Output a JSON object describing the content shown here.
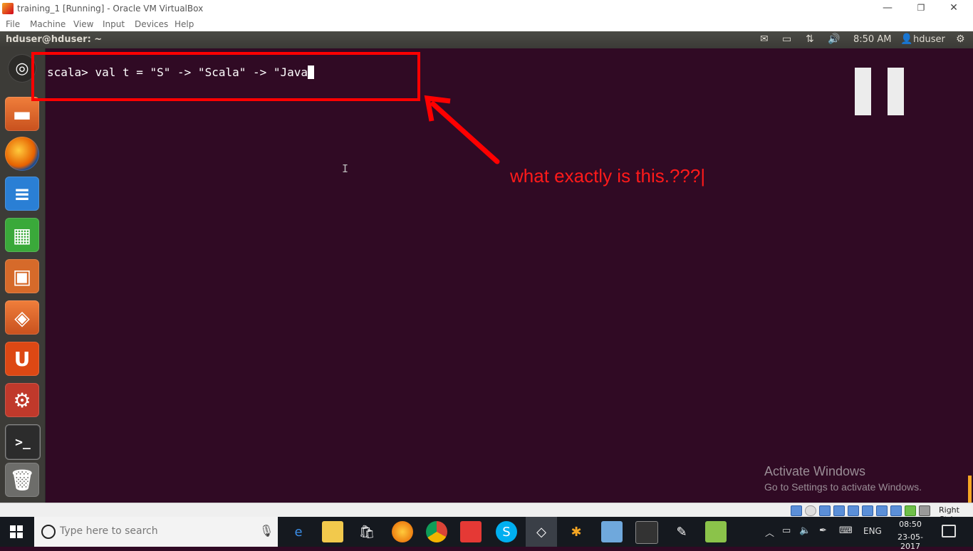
{
  "vbox": {
    "title": "training_1 [Running] - Oracle VM VirtualBox",
    "window_controls": {
      "minimize": "—",
      "maximize": "❐",
      "close": "✕"
    },
    "menu": [
      "File",
      "Machine",
      "View",
      "Input",
      "Devices",
      "Help"
    ],
    "status_right": "Right Ctrl"
  },
  "ubuntu_panel": {
    "title": "hduser@hduser: ~",
    "clock": "8:50 AM",
    "user": "hduser",
    "icons": [
      "mail-icon",
      "battery-icon",
      "network-icon",
      "volume-icon",
      "user-icon",
      "gear-icon"
    ]
  },
  "launcher": {
    "items": [
      "dash-home",
      "files",
      "firefox",
      "libreoffice-writer",
      "libreoffice-calc",
      "libreoffice-impress",
      "software-center",
      "ubuntu-one",
      "system-settings",
      "terminal",
      "trash"
    ]
  },
  "terminal": {
    "prompt": "scala> ",
    "command": "val t = \"S\" -> \"Scala\" -> \"Java",
    "cursor_char": "\""
  },
  "annotation": {
    "text": "what exactly is this.???|",
    "color": "#ff1a1a"
  },
  "watermark": {
    "title": "Activate Windows",
    "subtitle": "Go to Settings to activate Windows."
  },
  "taskbar": {
    "search_placeholder": "Type here to search",
    "language": "ENG",
    "time": "08:50",
    "date": "23-05-2017"
  },
  "colors": {
    "terminal_bg": "#300a24",
    "launcher_bg": "#3c3b37",
    "annotation_red": "#ff0000",
    "taskbar_bg": "#15191f"
  }
}
